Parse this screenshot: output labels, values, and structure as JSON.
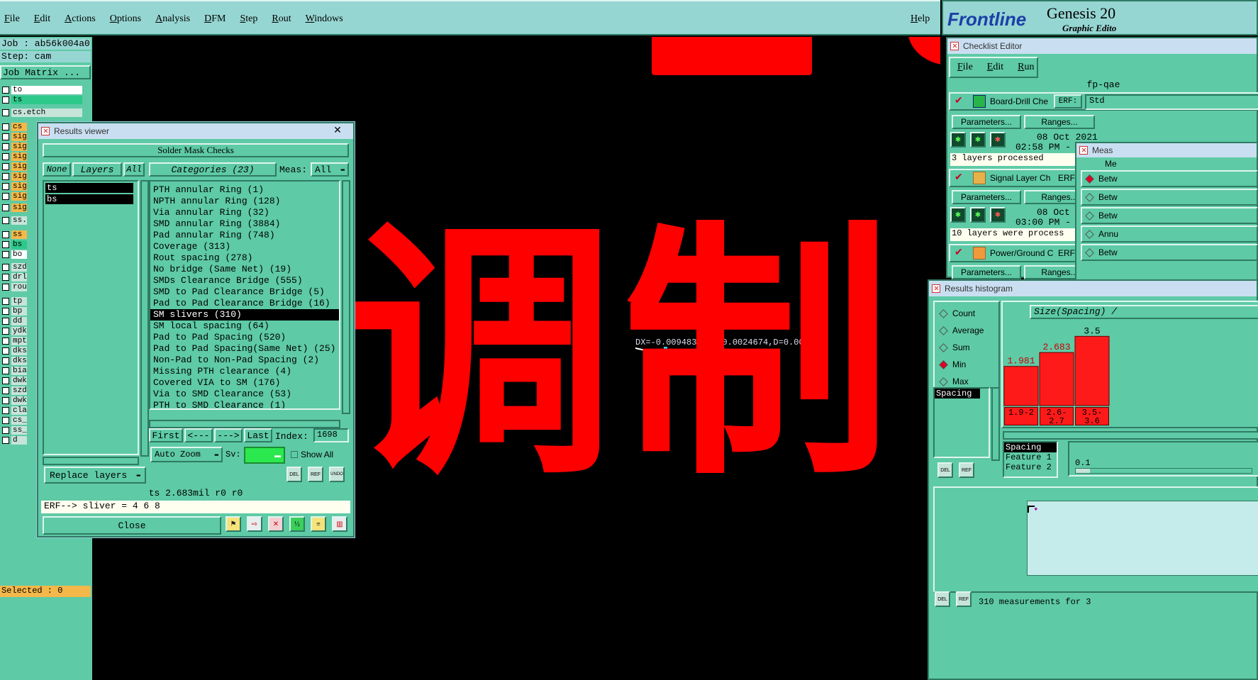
{
  "menubar": {
    "items": [
      "File",
      "Edit",
      "Actions",
      "Options",
      "Analysis",
      "DFM",
      "Step",
      "Rout",
      "Windows"
    ],
    "help": "Help"
  },
  "brand": {
    "logo": "Frontline",
    "product": "Genesis 20",
    "subtitle": "Graphic Edito"
  },
  "left_panel": {
    "job": "Job : ab56k004a0",
    "step": "Step: cam",
    "job_matrix": "Job Matrix ...",
    "selected": "Selected : 0",
    "layers": [
      "to",
      "ts",
      "cs.etch",
      "cs",
      "sig",
      "sig",
      "sig",
      "sig",
      "sig",
      "sig",
      "sig",
      "sig",
      "ss.",
      "ss",
      "bs",
      "bo",
      "szd",
      "drl",
      "rou",
      "tp",
      "bp",
      "dd",
      "ydk",
      "mpt",
      "dks",
      "dks",
      "bia",
      "dwk",
      "szd",
      "dwk",
      "cla",
      "cs_",
      "ss_",
      "d"
    ]
  },
  "canvas": {
    "glyphs": "调制",
    "measure": "DX=-0.0094834,DY=0.0024674,D=0.009799",
    "colors": {
      "red": "#ff0000",
      "bg": "#000000"
    }
  },
  "results_viewer": {
    "title": "Results viewer",
    "header": "Solder Mask Checks",
    "none_btn": "None",
    "layers_btn": "Layers",
    "all_btn": "All",
    "categories_btn": "Categories (23)",
    "meas_label": "Meas:",
    "meas_value": "All",
    "layer_list": [
      "ts",
      "bs"
    ],
    "categories": [
      "PTH annular Ring (1)",
      "NPTH annular Ring (128)",
      "Via annular Ring (32)",
      "SMD annular Ring (3884)",
      "Pad annular Ring (748)",
      "Coverage (313)",
      "Rout spacing (278)",
      "No bridge (Same Net) (19)",
      "SMDs Clearance Bridge (555)",
      "SMD to Pad Clearance Bridge (5)",
      "Pad to Pad Clearance Bridge (16)",
      "SM slivers (310)",
      "SM local spacing (64)",
      "Pad to Pad Spacing (520)",
      "Pad to Pad Spacing(Same Net) (25)",
      "Non-Pad to Non-Pad Spacing (2)",
      "Missing PTH clearance (4)",
      "Covered VIA to SM (176)",
      "Via to SMD Clearance (53)",
      "PTH to SMD Clearance (1)"
    ],
    "selected_index": 11,
    "first_btn": "First",
    "prev_btn": "<---",
    "next_btn": "--->",
    "last_btn": "Last",
    "index_label": "Index:",
    "index_value": "1698",
    "auto_zoom": "Auto Zoom",
    "sv_label": "Sv:",
    "show_all": "Show All",
    "replace_layers": "Replace layers",
    "del_icon": "DEL",
    "ref_icon": "REF",
    "undo_icon": "UNDO",
    "status": "ts 2.683mil  r0  r0",
    "erf": "ERF--> sliver = 4 6 8",
    "close_btn": "Close"
  },
  "checklist": {
    "title": "Checklist Editor",
    "menu": [
      "File",
      "Edit",
      "Run"
    ],
    "name": "fp-qae",
    "erf_label": "ERF:",
    "erf_value": "Std",
    "params_btn": "Parameters...",
    "ranges_btn": "Ranges...",
    "checks": [
      {
        "name": "Board-Drill Che",
        "date": "08 Oct 2021",
        "time": "02:58 PM -",
        "msg": "3 layers processed"
      },
      {
        "name": "Signal Layer Ch",
        "date": "08 Oct",
        "time": "03:00 PM -",
        "msg": "10 layers were process"
      },
      {
        "name": "Power/Ground C",
        "date": "",
        "time": "",
        "msg": ""
      }
    ]
  },
  "meas_panel": {
    "title": "Meas",
    "header": "Me",
    "items": [
      "Betw",
      "Betw",
      "Betw",
      "Annu",
      "Betw"
    ]
  },
  "histogram": {
    "title": "Results histogram",
    "options": [
      "Count",
      "Average",
      "Sum",
      "Min",
      "Max"
    ],
    "selected_option": "Min",
    "list_item": "Spacing",
    "axis_title": "Size(Spacing) /",
    "info": [
      "Spacing",
      "Feature 1",
      "Feature 2"
    ],
    "scale_value": "0.1",
    "footer": "310 measurements for 3"
  },
  "chart_data": {
    "type": "bar",
    "categories": [
      "1.9-2",
      "2.6-2.7",
      "3.5-3.6"
    ],
    "values": [
      1.981,
      2.683,
      3.5
    ],
    "title": "",
    "xlabel": "",
    "ylabel": "Size(Spacing) /",
    "ylim": [
      0,
      4.3
    ]
  }
}
